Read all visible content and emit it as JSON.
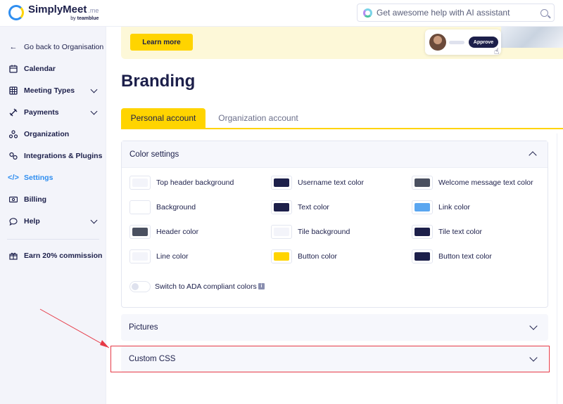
{
  "app": {
    "logo_name": "SimplyMeet",
    "logo_suffix": ".me",
    "logo_by_prefix": "by",
    "logo_by_brand": "teamblue"
  },
  "ai_search": {
    "placeholder": "Get awesome help with AI assistant"
  },
  "sidebar": {
    "back": "Go back to Organisation",
    "items": [
      {
        "label": "Calendar",
        "icon": "calendar-icon"
      },
      {
        "label": "Meeting Types",
        "icon": "grid-icon"
      },
      {
        "label": "Payments",
        "icon": "tag-icon"
      },
      {
        "label": "Organization",
        "icon": "org-icon"
      },
      {
        "label": "Integrations & Plugins",
        "icon": "plugin-icon"
      },
      {
        "label": "Settings",
        "icon": "code-icon"
      },
      {
        "label": "Billing",
        "icon": "billing-icon"
      },
      {
        "label": "Help",
        "icon": "chat-icon"
      }
    ],
    "earn": "Earn 20% commission"
  },
  "banner": {
    "learn_more": "Learn more",
    "approve": "Approve"
  },
  "page": {
    "title": "Branding"
  },
  "tabs": {
    "personal": "Personal account",
    "organization": "Organization account"
  },
  "color_settings": {
    "title": "Color settings",
    "items": [
      {
        "label": "Top header background",
        "color": "#f3f4fa"
      },
      {
        "label": "Username text color",
        "color": "#1c1f4a"
      },
      {
        "label": "Welcome message text color",
        "color": "#4a5060"
      },
      {
        "label": "Background",
        "color": "#ffffff"
      },
      {
        "label": "Text color",
        "color": "#1c1f4a"
      },
      {
        "label": "Link color",
        "color": "#5aa6f0"
      },
      {
        "label": "Header color",
        "color": "#4a5060"
      },
      {
        "label": "Tile background",
        "color": "#f3f4fa"
      },
      {
        "label": "Tile text color",
        "color": "#1c1f4a"
      },
      {
        "label": "Line color",
        "color": "#f3f4fa"
      },
      {
        "label": "Button color",
        "color": "#ffd400"
      },
      {
        "label": "Button text color",
        "color": "#1c1f4a"
      }
    ],
    "ada_toggle": "Switch to ADA compliant colors",
    "ada_enabled": false
  },
  "sections": {
    "pictures": "Pictures",
    "custom_css": "Custom CSS"
  }
}
